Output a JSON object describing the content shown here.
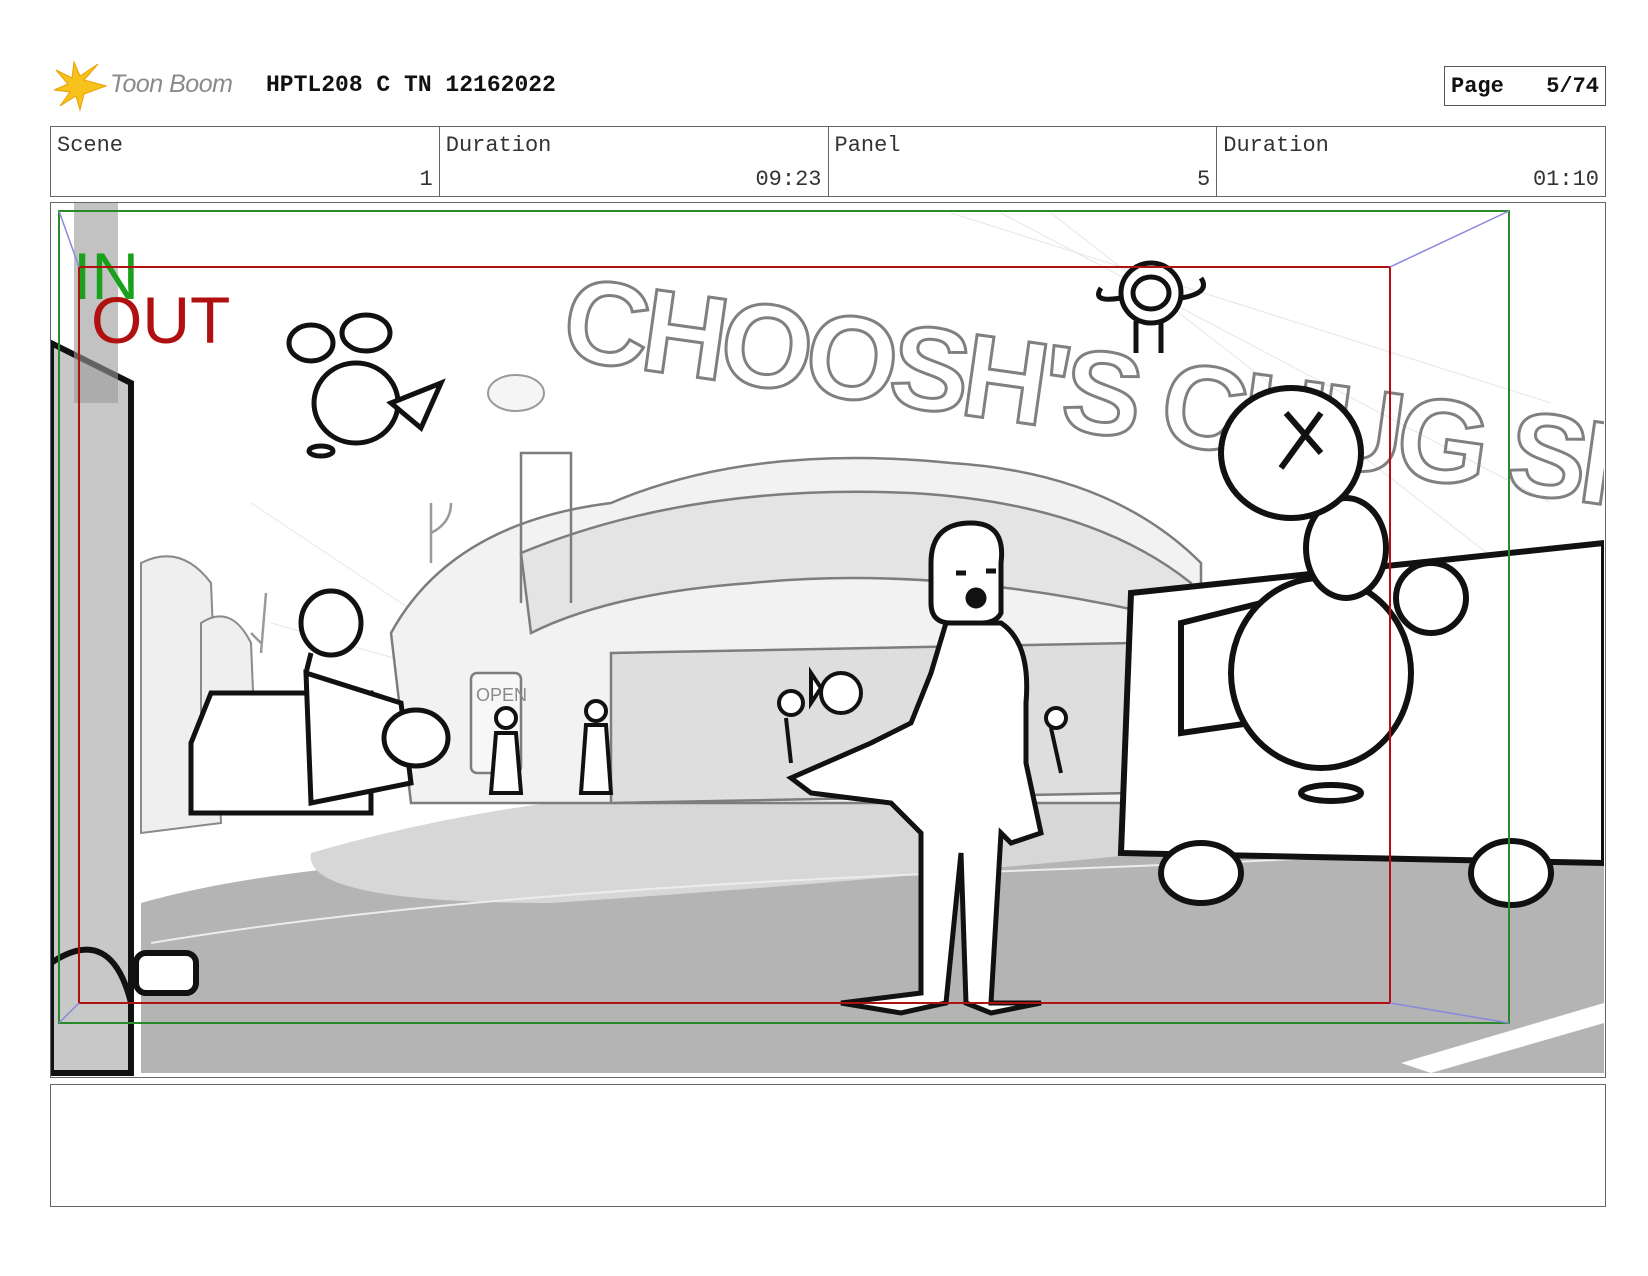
{
  "header": {
    "logo_text": "Toon Boom",
    "doc_title": "HPTL208 C TN 12162022",
    "page_label": "Page",
    "page_value": "5/74"
  },
  "info": {
    "scene_label": "Scene",
    "scene_value": "1",
    "scene_duration_label": "Duration",
    "scene_duration_value": "09:23",
    "panel_label": "Panel",
    "panel_value": "5",
    "panel_duration_label": "Duration",
    "panel_duration_value": "01:10"
  },
  "panel": {
    "in_label": "IN",
    "out_label": "OUT",
    "sign_main": "CHOOSH'S CHUG SHOP",
    "sign_open": "OPEN",
    "in_color": "#1aa01a",
    "out_color": "#b01010"
  },
  "notes": {
    "text": ""
  }
}
